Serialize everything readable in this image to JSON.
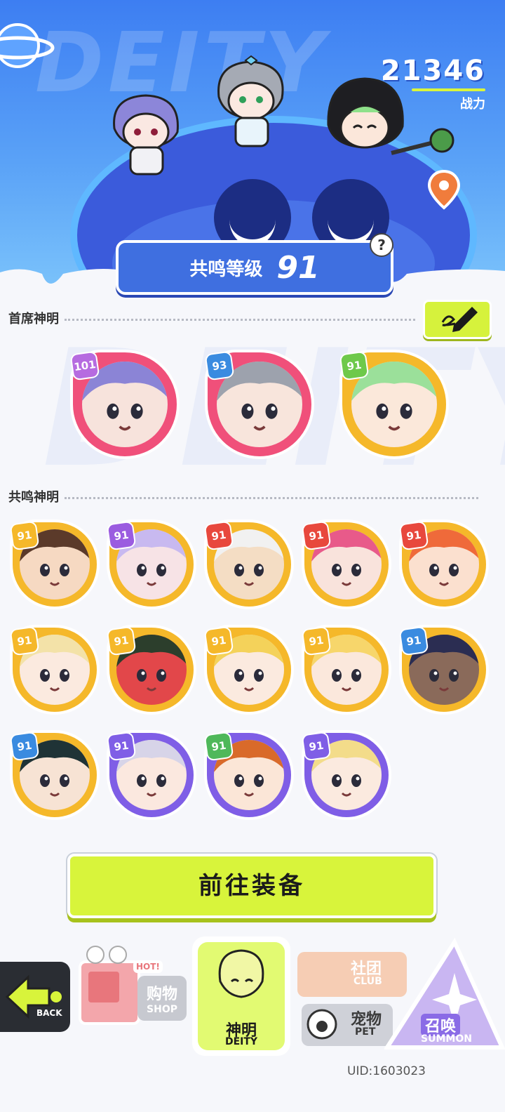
{
  "hero": {
    "bg_word": "DEITY",
    "power_value": "21346",
    "power_label": "战力",
    "level_label": "共鸣等级",
    "level_value": "91",
    "help_symbol": "?"
  },
  "sections": {
    "chief_title": "首席神明",
    "resonance_title": "共鸣神明",
    "edit_icon": "pencil-icon"
  },
  "chief_deities": [
    {
      "level": "101",
      "ring": "#f0507a",
      "badge": "#b66be0",
      "hair": "#8b84d6",
      "skin": "#f7e3dc"
    },
    {
      "level": "93",
      "ring": "#f0507a",
      "badge": "#3a8be0",
      "hair": "#9da2ad",
      "skin": "#f8e5dc"
    },
    {
      "level": "91",
      "ring": "#f5b82a",
      "badge": "#6ec94a",
      "hair": "#9be09a",
      "skin": "#fbe8da"
    }
  ],
  "resonance_deities": [
    {
      "level": "91",
      "ring": "#f5b82a",
      "badge": "#f5b82a",
      "hair": "#5b3a2a",
      "skin": "#f6d9c2"
    },
    {
      "level": "91",
      "ring": "#f5b82a",
      "badge": "#9b5ce0",
      "hair": "#c8b9f0",
      "skin": "#f7e3e6"
    },
    {
      "level": "91",
      "ring": "#f5b82a",
      "badge": "#e8483d",
      "hair": "#f1f1f1",
      "skin": "#f4ddc4"
    },
    {
      "level": "91",
      "ring": "#f5b82a",
      "badge": "#e8483d",
      "hair": "#e85a8a",
      "skin": "#f9e3dc"
    },
    {
      "level": "91",
      "ring": "#f5b82a",
      "badge": "#e8483d",
      "hair": "#ef6a3a",
      "skin": "#fbe0cf"
    },
    {
      "level": "91",
      "ring": "#f5b82a",
      "badge": "#f5b82a",
      "hair": "#f3e2a8",
      "skin": "#fbeadf"
    },
    {
      "level": "91",
      "ring": "#f5b82a",
      "badge": "#f5b82a",
      "hair": "#2c3e2c",
      "skin": "#e2474a"
    },
    {
      "level": "91",
      "ring": "#f5b82a",
      "badge": "#f5b82a",
      "hair": "#f4d25a",
      "skin": "#fbeadf"
    },
    {
      "level": "91",
      "ring": "#f5b82a",
      "badge": "#f5b82a",
      "hair": "#f7d66b",
      "skin": "#fbe8dc"
    },
    {
      "level": "91",
      "ring": "#f5b82a",
      "badge": "#3a8be0",
      "hair": "#2b2d52",
      "skin": "#8a6a5a"
    },
    {
      "level": "91",
      "ring": "#f5b82a",
      "badge": "#3a8be0",
      "hair": "#1f3336",
      "skin": "#f7e3d4"
    },
    {
      "level": "91",
      "ring": "#7f5ee6",
      "badge": "#7f5ee6",
      "hair": "#d7d4e8",
      "skin": "#fbe8df"
    },
    {
      "level": "91",
      "ring": "#7f5ee6",
      "badge": "#4fb85a",
      "hair": "#d96a2a",
      "skin": "#fbe6d7"
    },
    {
      "level": "91",
      "ring": "#7f5ee6",
      "badge": "#7f5ee6",
      "hair": "#f3dc8a",
      "skin": "#fbeadf"
    }
  ],
  "actions": {
    "go_equip": "前往装备"
  },
  "nav": {
    "back_label": "BACK",
    "shop_badge": "HOT!",
    "shop_cn": "购物",
    "shop_en": "SHOP",
    "deity_cn": "神明",
    "deity_en": "DEITY",
    "club_cn": "社团",
    "club_en": "CLUB",
    "pet_cn": "宠物",
    "pet_en": "PET",
    "summon_cn": "召唤",
    "summon_en": "SUMMON"
  },
  "uid": "UID:1603023"
}
